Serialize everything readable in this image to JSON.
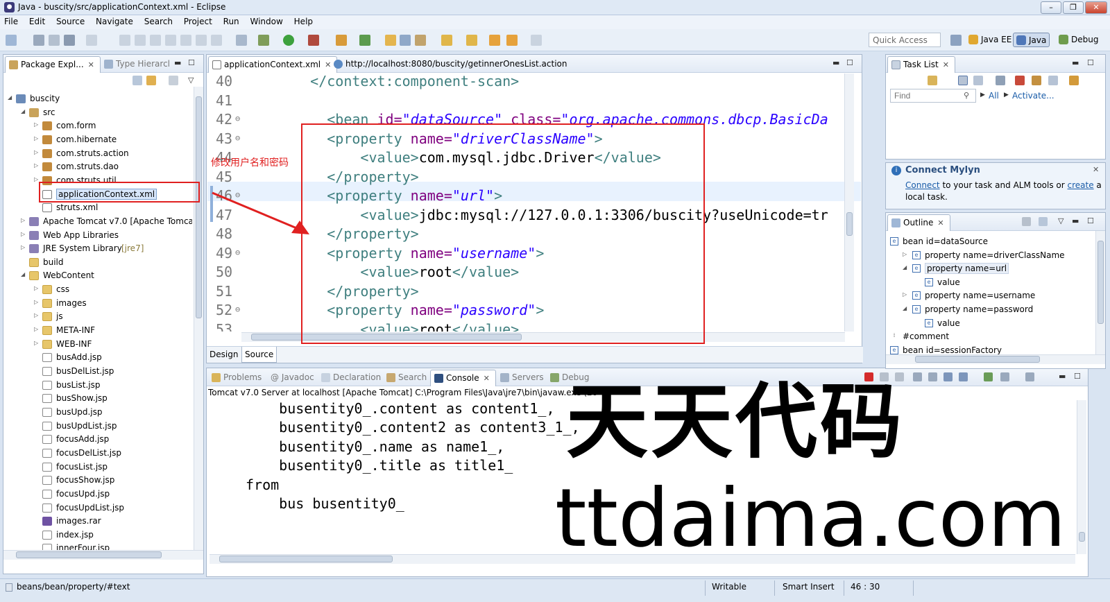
{
  "window": {
    "title": "Java - buscity/src/applicationContext.xml - Eclipse",
    "controls": [
      "minimize",
      "maximize",
      "close"
    ]
  },
  "menubar": [
    "File",
    "Edit",
    "Source",
    "Navigate",
    "Search",
    "Project",
    "Run",
    "Window",
    "Help"
  ],
  "toolbar": {
    "quick_access": "Quick Access",
    "perspectives": [
      "Java EE",
      "Java",
      "Debug"
    ]
  },
  "package_explorer": {
    "tabs": [
      "Package Expl...",
      "Type Hierarcl"
    ],
    "tree": [
      {
        "label": "buscity",
        "depth": 0,
        "icon": "project-icon",
        "expanded": true
      },
      {
        "label": "src",
        "depth": 1,
        "icon": "source-folder-icon",
        "expanded": true
      },
      {
        "label": "com.form",
        "depth": 2,
        "icon": "package-icon",
        "expanded": false
      },
      {
        "label": "com.hibernate",
        "depth": 2,
        "icon": "package-icon",
        "expanded": false
      },
      {
        "label": "com.struts.action",
        "depth": 2,
        "icon": "package-icon",
        "expanded": false
      },
      {
        "label": "com.struts.dao",
        "depth": 2,
        "icon": "package-icon",
        "expanded": false
      },
      {
        "label": "com.struts.util",
        "depth": 2,
        "icon": "package-icon",
        "expanded": false
      },
      {
        "label": "applicationContext.xml",
        "depth": 2,
        "icon": "xml-file-icon",
        "selected": true
      },
      {
        "label": "struts.xml",
        "depth": 2,
        "icon": "xml-file-icon"
      },
      {
        "label": "Apache Tomcat v7.0 [Apache Tomca",
        "depth": 1,
        "icon": "library-icon",
        "expanded": false
      },
      {
        "label": "Web App Libraries",
        "depth": 1,
        "icon": "library-icon",
        "expanded": false
      },
      {
        "label": "JRE System Library",
        "suffix": "[jre7]",
        "depth": 1,
        "icon": "library-icon",
        "expanded": false
      },
      {
        "label": "build",
        "depth": 1,
        "icon": "folder-icon"
      },
      {
        "label": "WebContent",
        "depth": 1,
        "icon": "folder-icon",
        "expanded": true
      },
      {
        "label": "css",
        "depth": 2,
        "icon": "folder-icon",
        "expanded": false
      },
      {
        "label": "images",
        "depth": 2,
        "icon": "folder-icon",
        "expanded": false
      },
      {
        "label": "js",
        "depth": 2,
        "icon": "folder-icon",
        "expanded": false
      },
      {
        "label": "META-INF",
        "depth": 2,
        "icon": "folder-icon",
        "expanded": false
      },
      {
        "label": "WEB-INF",
        "depth": 2,
        "icon": "folder-icon",
        "expanded": false
      },
      {
        "label": "busAdd.jsp",
        "depth": 2,
        "icon": "jsp-file-icon"
      },
      {
        "label": "busDelList.jsp",
        "depth": 2,
        "icon": "jsp-file-icon"
      },
      {
        "label": "busList.jsp",
        "depth": 2,
        "icon": "jsp-file-icon"
      },
      {
        "label": "busShow.jsp",
        "depth": 2,
        "icon": "jsp-file-icon"
      },
      {
        "label": "busUpd.jsp",
        "depth": 2,
        "icon": "jsp-file-icon"
      },
      {
        "label": "busUpdList.jsp",
        "depth": 2,
        "icon": "jsp-file-icon"
      },
      {
        "label": "focusAdd.jsp",
        "depth": 2,
        "icon": "jsp-file-icon"
      },
      {
        "label": "focusDelList.jsp",
        "depth": 2,
        "icon": "jsp-file-icon"
      },
      {
        "label": "focusList.jsp",
        "depth": 2,
        "icon": "jsp-file-icon"
      },
      {
        "label": "focusShow.jsp",
        "depth": 2,
        "icon": "jsp-file-icon"
      },
      {
        "label": "focusUpd.jsp",
        "depth": 2,
        "icon": "jsp-file-icon"
      },
      {
        "label": "focusUpdList.jsp",
        "depth": 2,
        "icon": "jsp-file-icon"
      },
      {
        "label": "images.rar",
        "depth": 2,
        "icon": "archive-icon"
      },
      {
        "label": "index.jsp",
        "depth": 2,
        "icon": "jsp-file-icon"
      },
      {
        "label": "innerFour.jsp",
        "depth": 2,
        "icon": "jsp-file-icon"
      }
    ]
  },
  "editor": {
    "tabs": [
      "applicationContext.xml",
      "http://localhost:8080/buscity/getinnerOnesList.action"
    ],
    "bottom_tabs": [
      "Design",
      "Source"
    ],
    "lines": [
      {
        "n": "40",
        "fold": "",
        "indent": "    ",
        "parts": [
          [
            "tag",
            "</context:component-scan>"
          ]
        ]
      },
      {
        "n": "41",
        "fold": "",
        "indent": "",
        "parts": []
      },
      {
        "n": "42",
        "fold": "⊖",
        "indent": "      ",
        "parts": [
          [
            "tag",
            "<bean "
          ],
          [
            "attr",
            "id="
          ],
          [
            "str",
            "\"dataSource\""
          ],
          [
            "txt",
            " "
          ],
          [
            "attr",
            "class="
          ],
          [
            "str",
            "\"org.apache.commons.dbcp.BasicDa"
          ]
        ]
      },
      {
        "n": "43",
        "fold": "⊖",
        "indent": "      ",
        "parts": [
          [
            "tag",
            "<property "
          ],
          [
            "attr",
            "name="
          ],
          [
            "str",
            "\"driverClassName\""
          ],
          [
            "tag",
            ">"
          ]
        ]
      },
      {
        "n": "44",
        "fold": "",
        "indent": "          ",
        "parts": [
          [
            "tag",
            "<value>"
          ],
          [
            "txt",
            "com.mysql.jdbc.Driver"
          ],
          [
            "tag",
            "</value>"
          ]
        ]
      },
      {
        "n": "45",
        "fold": "",
        "indent": "      ",
        "parts": [
          [
            "tag",
            "</property>"
          ]
        ]
      },
      {
        "n": "46",
        "fold": "⊖",
        "indent": "      ",
        "parts": [
          [
            "tag",
            "<property "
          ],
          [
            "attr",
            "name="
          ],
          [
            "str",
            "\"url\""
          ],
          [
            "tag",
            ">"
          ]
        ]
      },
      {
        "n": "47",
        "fold": "",
        "indent": "          ",
        "parts": [
          [
            "tag",
            "<value>"
          ],
          [
            "txt",
            "jdbc:mysql://127.0.0.1:3306/buscity?useUnicode=tr"
          ]
        ]
      },
      {
        "n": "48",
        "fold": "",
        "indent": "      ",
        "parts": [
          [
            "tag",
            "</property>"
          ]
        ]
      },
      {
        "n": "49",
        "fold": "⊖",
        "indent": "      ",
        "parts": [
          [
            "tag",
            "<property "
          ],
          [
            "attr",
            "name="
          ],
          [
            "str",
            "\"username\""
          ],
          [
            "tag",
            ">"
          ]
        ]
      },
      {
        "n": "50",
        "fold": "",
        "indent": "          ",
        "parts": [
          [
            "tag",
            "<value>"
          ],
          [
            "txt",
            "root"
          ],
          [
            "tag",
            "</value>"
          ]
        ]
      },
      {
        "n": "51",
        "fold": "",
        "indent": "      ",
        "parts": [
          [
            "tag",
            "</property>"
          ]
        ]
      },
      {
        "n": "52",
        "fold": "⊖",
        "indent": "      ",
        "parts": [
          [
            "tag",
            "<property "
          ],
          [
            "attr",
            "name="
          ],
          [
            "str",
            "\"password\""
          ],
          [
            "tag",
            ">"
          ]
        ]
      },
      {
        "n": "53",
        "fold": "",
        "indent": "          ",
        "parts": [
          [
            "tag",
            "<value>"
          ],
          [
            "txt",
            "root"
          ],
          [
            "tag",
            "</value>"
          ]
        ]
      }
    ]
  },
  "annotation": {
    "label": "修改用户名和密码"
  },
  "console": {
    "tabs": [
      "Problems",
      "@ Javadoc",
      "Declaration",
      "Search",
      "Console",
      "Servers",
      "Debug"
    ],
    "header": "Tomcat v7.0 Server at localhost [Apache Tomcat] C:\\Program Files\\Java\\jre7\\bin\\javaw.exe (20",
    "lines": [
      "    busentity0_.content as content1_,",
      "    busentity0_.content2 as content3_1_,",
      "    busentity0_.name as name1_,",
      "    busentity0_.title as title1_",
      "from",
      "    bus busentity0_"
    ]
  },
  "task_list": {
    "tab": "Task List",
    "find_placeholder": "Find",
    "all": "All",
    "activate": "Activate..."
  },
  "mylyn": {
    "title": "Connect Mylyn",
    "connect": "Connect",
    "text1": " to your task and ALM tools or ",
    "create": "create",
    "text2": " a",
    "text3": "local task."
  },
  "outline": {
    "tab": "Outline",
    "rows": [
      {
        "label": "bean id=dataSource",
        "depth": 0,
        "arrow": ""
      },
      {
        "label": "property name=driverClassName",
        "depth": 1,
        "arrow": "▷"
      },
      {
        "label": "property name=url",
        "depth": 1,
        "arrow": "◢"
      },
      {
        "label": "value",
        "depth": 2,
        "arrow": ""
      },
      {
        "label": "property name=username",
        "depth": 1,
        "arrow": "▷"
      },
      {
        "label": "property name=password",
        "depth": 1,
        "arrow": "◢"
      },
      {
        "label": "value",
        "depth": 2,
        "arrow": ""
      },
      {
        "label": "#comment",
        "depth": 0,
        "arrow": "",
        "comment": true
      },
      {
        "label": "bean id=sessionFactory",
        "depth": 0,
        "arrow": ""
      }
    ]
  },
  "statusbar": {
    "path": "beans/bean/property/#text",
    "writable": "Writable",
    "insert_mode": "Smart Insert",
    "position": "46 : 30"
  },
  "watermark": {
    "cn": "天天代码",
    "en": "ttdaima.com"
  },
  "colors": {
    "annotation_red": "#e02020",
    "tag": "#3f7f7f",
    "attribute": "#7f007f",
    "string": "#2a00ff"
  }
}
